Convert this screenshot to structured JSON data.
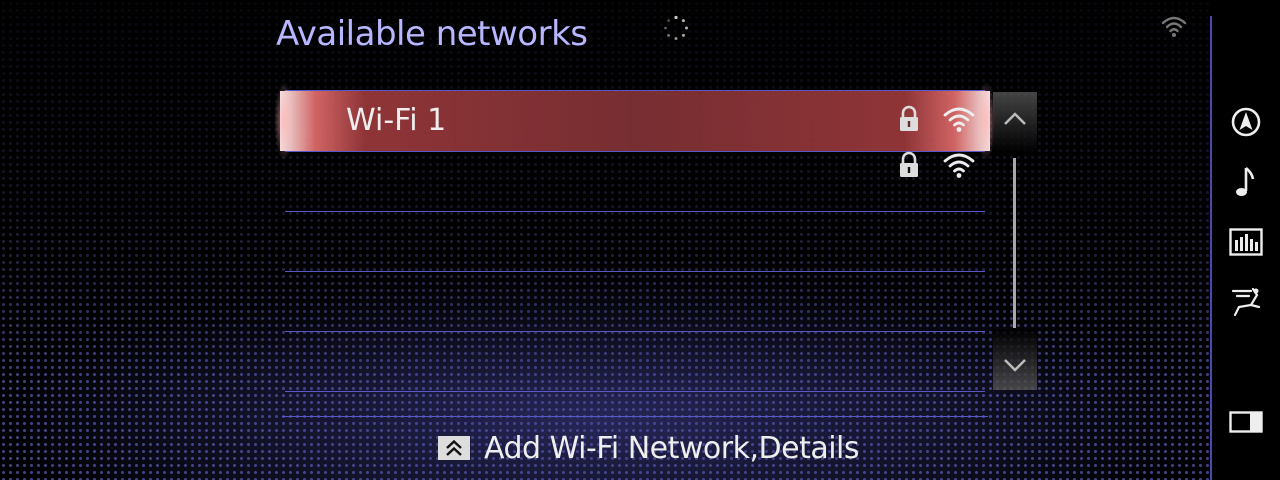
{
  "header": {
    "title": "Available networks",
    "icons": [
      "loading-spinner-icon",
      "wifi-status-icon"
    ]
  },
  "networks": [
    {
      "name": "Wi-Fi 1",
      "secured": true,
      "signal": "full",
      "selected": true
    },
    {
      "name": "",
      "secured": true,
      "signal": "full",
      "selected": false
    },
    {
      "name": "",
      "secured": false,
      "signal": "none",
      "selected": false
    },
    {
      "name": "",
      "secured": false,
      "signal": "none",
      "selected": false
    },
    {
      "name": "",
      "secured": false,
      "signal": "none",
      "selected": false
    }
  ],
  "footer": {
    "add_label": "Add Wi-Fi Network,Details",
    "add_icon": "chevron-double-up-icon"
  },
  "sidebar": {
    "items": [
      "navigation-icon",
      "music-note-icon",
      "audio-bars-icon",
      "climate-seat-icon",
      "screen-split-icon"
    ]
  },
  "colors": {
    "title": "#b8b6ff",
    "selected_row": "#7d3034",
    "divider": "#5a58c8",
    "sidebar_border": "#4b49b0"
  }
}
